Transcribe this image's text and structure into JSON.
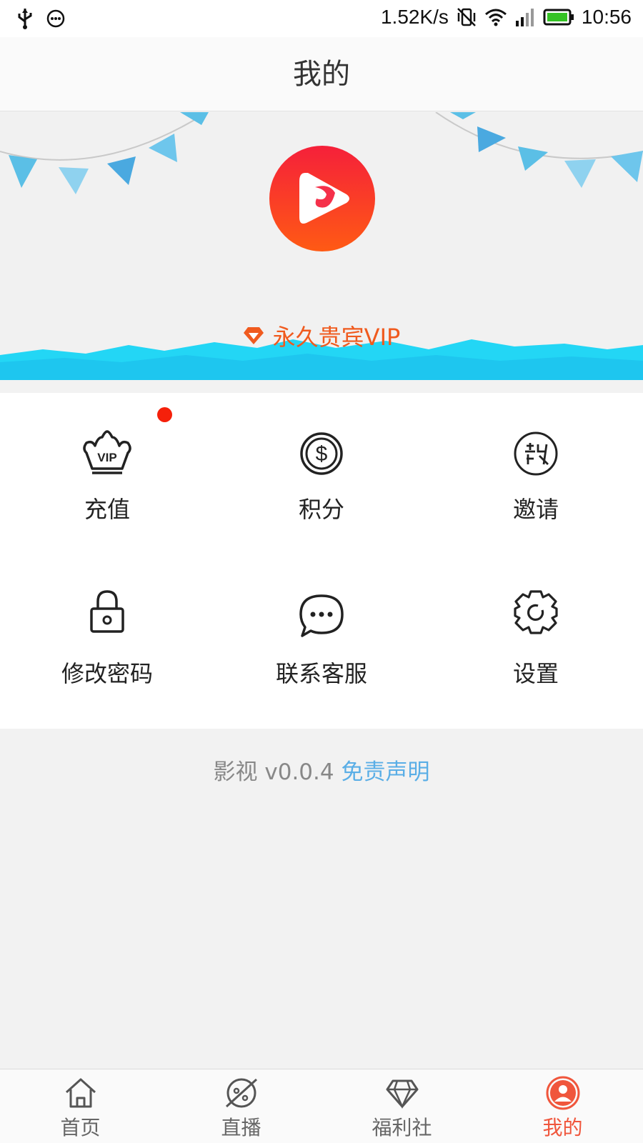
{
  "status_bar": {
    "net_speed": "1.52K/s",
    "time": "10:56",
    "icons": [
      "usb-icon",
      "message-icon",
      "vibrate-icon",
      "wifi-icon",
      "signal-icon",
      "battery-icon"
    ]
  },
  "header": {
    "title": "我的"
  },
  "banner": {
    "vip_text": "永久贵宾VIP",
    "accent": "#f05a1e"
  },
  "menu": [
    {
      "label": "充值",
      "icon": "vip-crown-icon",
      "badge": true
    },
    {
      "label": "积分",
      "icon": "coin-icon"
    },
    {
      "label": "邀请",
      "icon": "invite-icon"
    },
    {
      "label": "修改密码",
      "icon": "lock-icon"
    },
    {
      "label": "联系客服",
      "icon": "chat-bubble-icon"
    },
    {
      "label": "设置",
      "icon": "settings-gear-icon"
    }
  ],
  "footer": {
    "version": "影视 v0.0.4",
    "disclaimer": "免责声明",
    "link_color": "#5aaee6"
  },
  "tabbar": {
    "tabs": [
      {
        "label": "首页",
        "icon": "home-icon"
      },
      {
        "label": "直播",
        "icon": "live-icon"
      },
      {
        "label": "福利社",
        "icon": "diamond-icon"
      },
      {
        "label": "我的",
        "icon": "profile-icon",
        "active": true
      }
    ],
    "active_color": "#f0563c"
  }
}
